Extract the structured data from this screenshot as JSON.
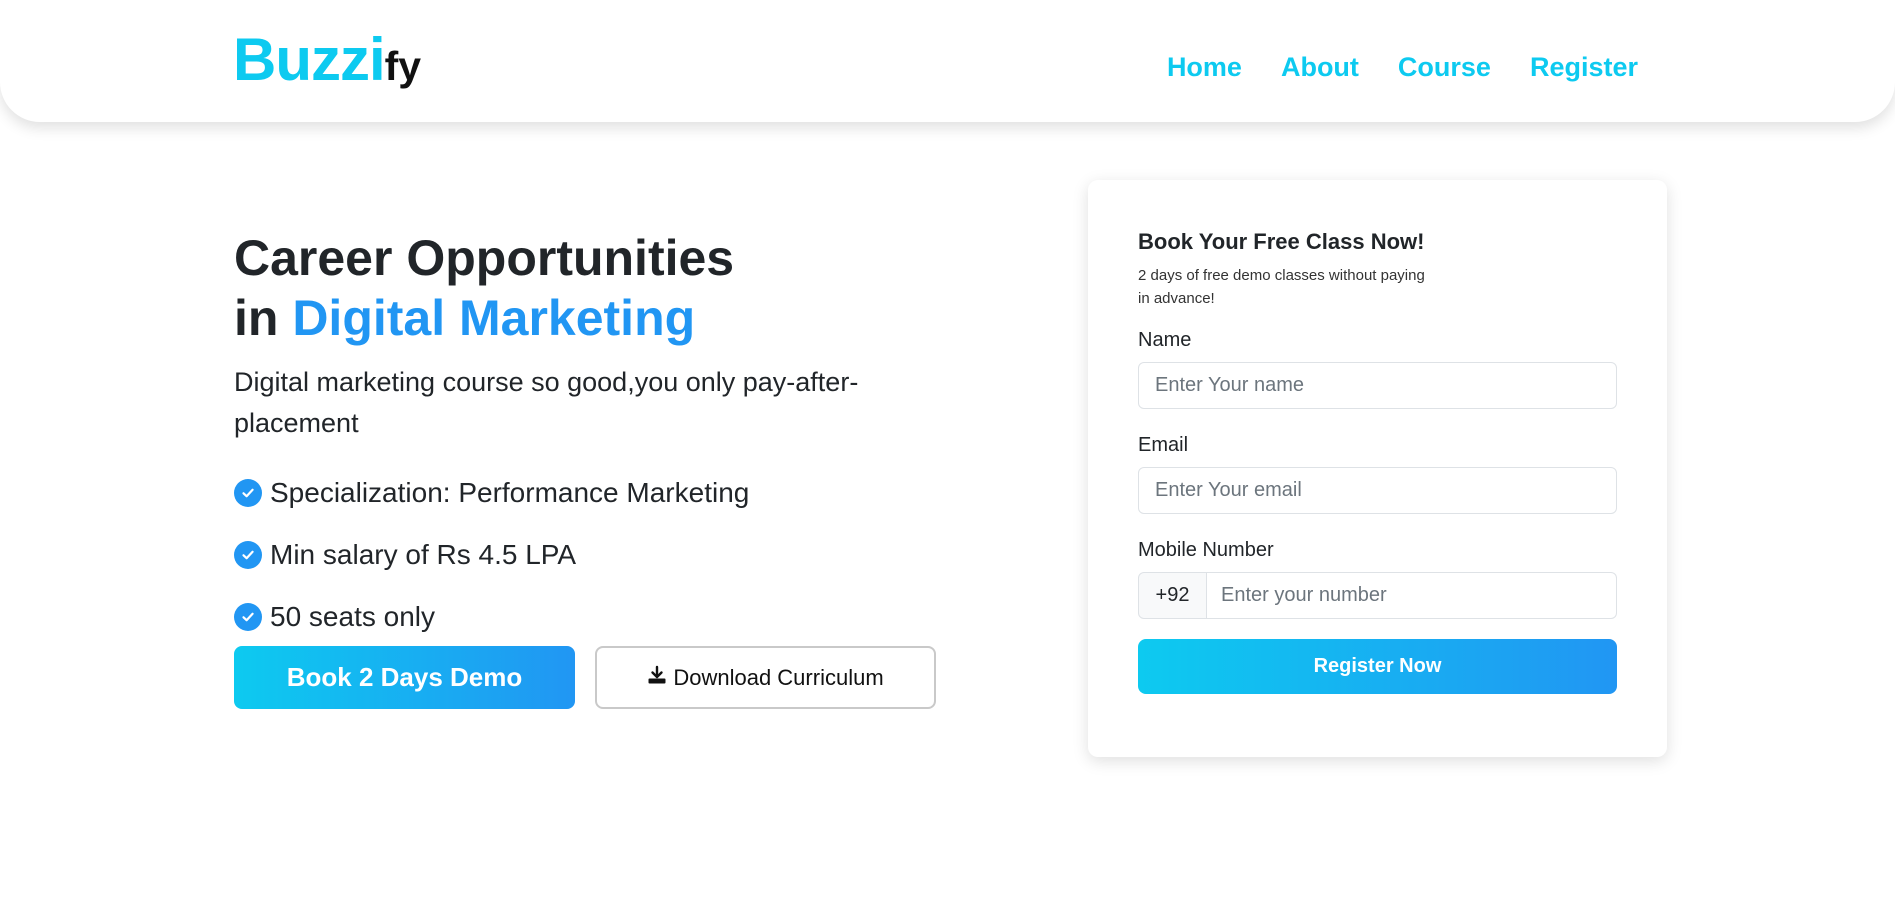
{
  "header": {
    "logo_primary": "Buzzi",
    "logo_secondary": "fy",
    "nav": [
      {
        "label": "Home"
      },
      {
        "label": "About"
      },
      {
        "label": "Course"
      },
      {
        "label": "Register"
      }
    ]
  },
  "hero": {
    "title_line1": "Career Opportunities",
    "title_prefix": "in ",
    "title_accent": "Digital Marketing",
    "subtitle": "Digital marketing course so good,you only pay-after-placement",
    "features": [
      {
        "text": "Specialization: Performance Marketing",
        "icon": "check-circle-icon"
      },
      {
        "text": "Min salary of Rs 4.5 LPA",
        "icon": "check-circle-icon"
      },
      {
        "text": "50 seats only",
        "icon": "check-circle-icon"
      }
    ],
    "primary_button": "Book 2 Days Demo",
    "secondary_button": "Download Curriculum",
    "secondary_button_icon": "download-icon"
  },
  "form": {
    "title": "Book Your Free Class Now!",
    "subtitle": "2 days of free demo classes without paying in advance!",
    "name_label": "Name",
    "name_placeholder": "Enter Your name",
    "email_label": "Email",
    "email_placeholder": "Enter Your email",
    "mobile_label": "Mobile Number",
    "mobile_prefix": "+92",
    "mobile_placeholder": "Enter your number",
    "submit_label": "Register Now"
  },
  "colors": {
    "brand": "#0dcaf0",
    "accent": "#2196f3",
    "text": "#212529"
  }
}
